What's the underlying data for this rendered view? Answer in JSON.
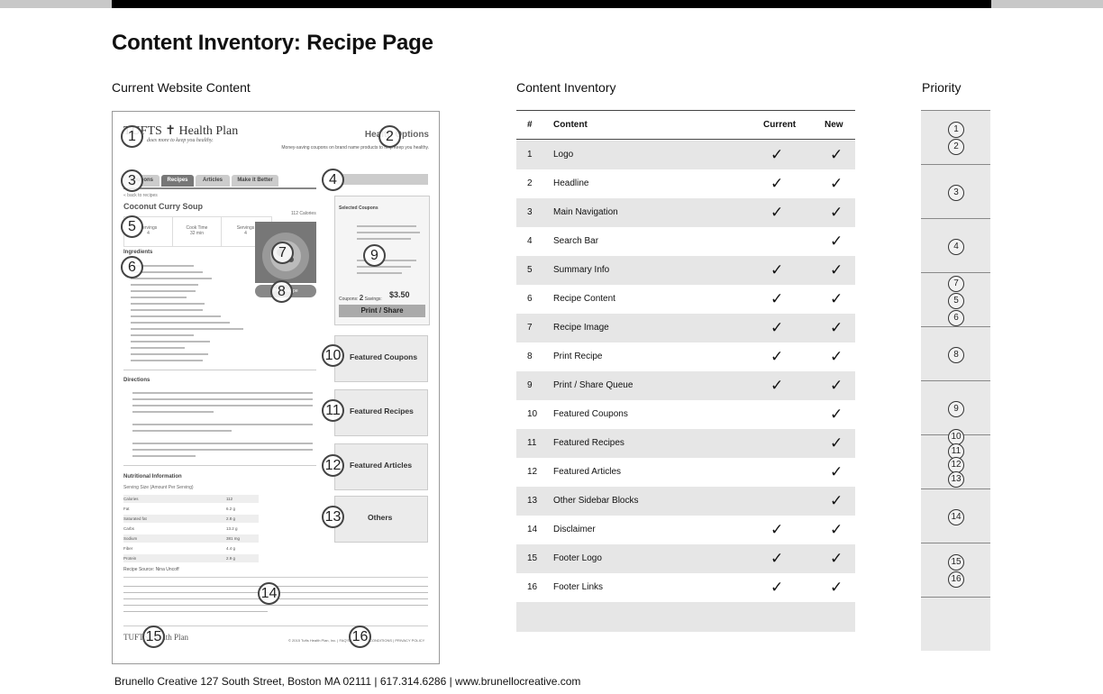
{
  "title": "Content Inventory: Recipe Page",
  "headers": {
    "current": "Current Website Content",
    "inventory": "Content Inventory",
    "priority": "Priority"
  },
  "footer": "Brunello Creative 127 South Street, Boston MA 02111 | 617.314.6286 | www.brunellocreative.com",
  "mock": {
    "logo": "TUFTS ✝ Health Plan",
    "logo_sub": "does more to keep you healthy.",
    "health_title": "Health Options",
    "health_sub": "Money-saving coupons on brand name products to help keep you healthy.",
    "tabs": [
      "Coupons",
      "Recipes",
      "Articles",
      "Make it Better"
    ],
    "back_link": "« back to recipes",
    "recipe_title": "Coconut Curry Soup",
    "calories": "112 Calories",
    "summary": [
      {
        "label": "Servings",
        "value": "4"
      },
      {
        "label": "Cook Time",
        "value": "32 min"
      },
      {
        "label": "Servings",
        "value": "4"
      }
    ],
    "ingredients_heading": "Ingredients",
    "print_recipe": "Print Recipe",
    "directions_heading": "Directions",
    "nutrition_heading": "Nutritional Information",
    "serving_size": "Serving Size (Amount Per Serving)",
    "nutrition": [
      {
        "name": "Calories",
        "value": "112"
      },
      {
        "name": "Fat",
        "value": "6.2 g"
      },
      {
        "name": "Saturated fat",
        "value": "2.8 g"
      },
      {
        "name": "Carbs",
        "value": "13.2 g"
      },
      {
        "name": "Sodium",
        "value": "381 mg"
      },
      {
        "name": "Fiber",
        "value": "4.4 g"
      },
      {
        "name": "Protein",
        "value": "2.9 g"
      }
    ],
    "recipe_source": "Recipe Source: Nina Uncoff",
    "footer_logo": "TUFTS Health Plan",
    "footer_links": "© 2015 Tufts Health Plan, Inc.  |  FAQ'S  |  TERMS & CONDITIONS  |  PRIVACY POLICY",
    "selected_coupons": "Selected Coupons",
    "coupons_label": "Coupons:",
    "coupons_count": "2",
    "savings_label": "Savings:",
    "savings_value": "$3.50",
    "print_share": "Print / Share",
    "sidebar_blocks": [
      "Featured Coupons",
      "Featured Recipes",
      "Featured Articles",
      "Others"
    ]
  },
  "callouts": [
    "1",
    "2",
    "3",
    "4",
    "5",
    "6",
    "7",
    "8",
    "9",
    "10",
    "11",
    "12",
    "13",
    "14",
    "15",
    "16"
  ],
  "table": {
    "columns": [
      "#",
      "Content",
      "Current",
      "New"
    ],
    "rows": [
      {
        "num": "1",
        "content": "Logo",
        "current": "✓",
        "new": "✓"
      },
      {
        "num": "2",
        "content": "Headline",
        "current": "✓",
        "new": "✓"
      },
      {
        "num": "3",
        "content": "Main Navigation",
        "current": "✓",
        "new": "✓"
      },
      {
        "num": "4",
        "content": "Search Bar",
        "current": "",
        "new": "✓"
      },
      {
        "num": "5",
        "content": "Summary Info",
        "current": "✓",
        "new": "✓"
      },
      {
        "num": "6",
        "content": "Recipe Content",
        "current": "✓",
        "new": "✓"
      },
      {
        "num": "7",
        "content": "Recipe Image",
        "current": "✓",
        "new": "✓"
      },
      {
        "num": "8",
        "content": "Print Recipe",
        "current": "✓",
        "new": "✓"
      },
      {
        "num": "9",
        "content": "Print / Share Queue",
        "current": "✓",
        "new": "✓"
      },
      {
        "num": "10",
        "content": "Featured Coupons",
        "current": "",
        "new": "✓"
      },
      {
        "num": "11",
        "content": "Featured Recipes",
        "current": "",
        "new": "✓"
      },
      {
        "num": "12",
        "content": "Featured Articles",
        "current": "",
        "new": "✓"
      },
      {
        "num": "13",
        "content": "Other Sidebar Blocks",
        "current": "",
        "new": "✓"
      },
      {
        "num": "14",
        "content": "Disclaimer",
        "current": "✓",
        "new": "✓"
      },
      {
        "num": "15",
        "content": "Footer Logo",
        "current": "✓",
        "new": "✓"
      },
      {
        "num": "16",
        "content": "Footer Links",
        "current": "✓",
        "new": "✓"
      }
    ]
  },
  "priority": [
    [
      "1",
      "2"
    ],
    [
      "3"
    ],
    [
      "4"
    ],
    [
      "7",
      "5",
      "6"
    ],
    [
      "8"
    ],
    [
      "9"
    ],
    [
      "10",
      "11",
      "12",
      "13"
    ],
    [
      "14"
    ],
    [
      "15",
      "16"
    ],
    []
  ]
}
